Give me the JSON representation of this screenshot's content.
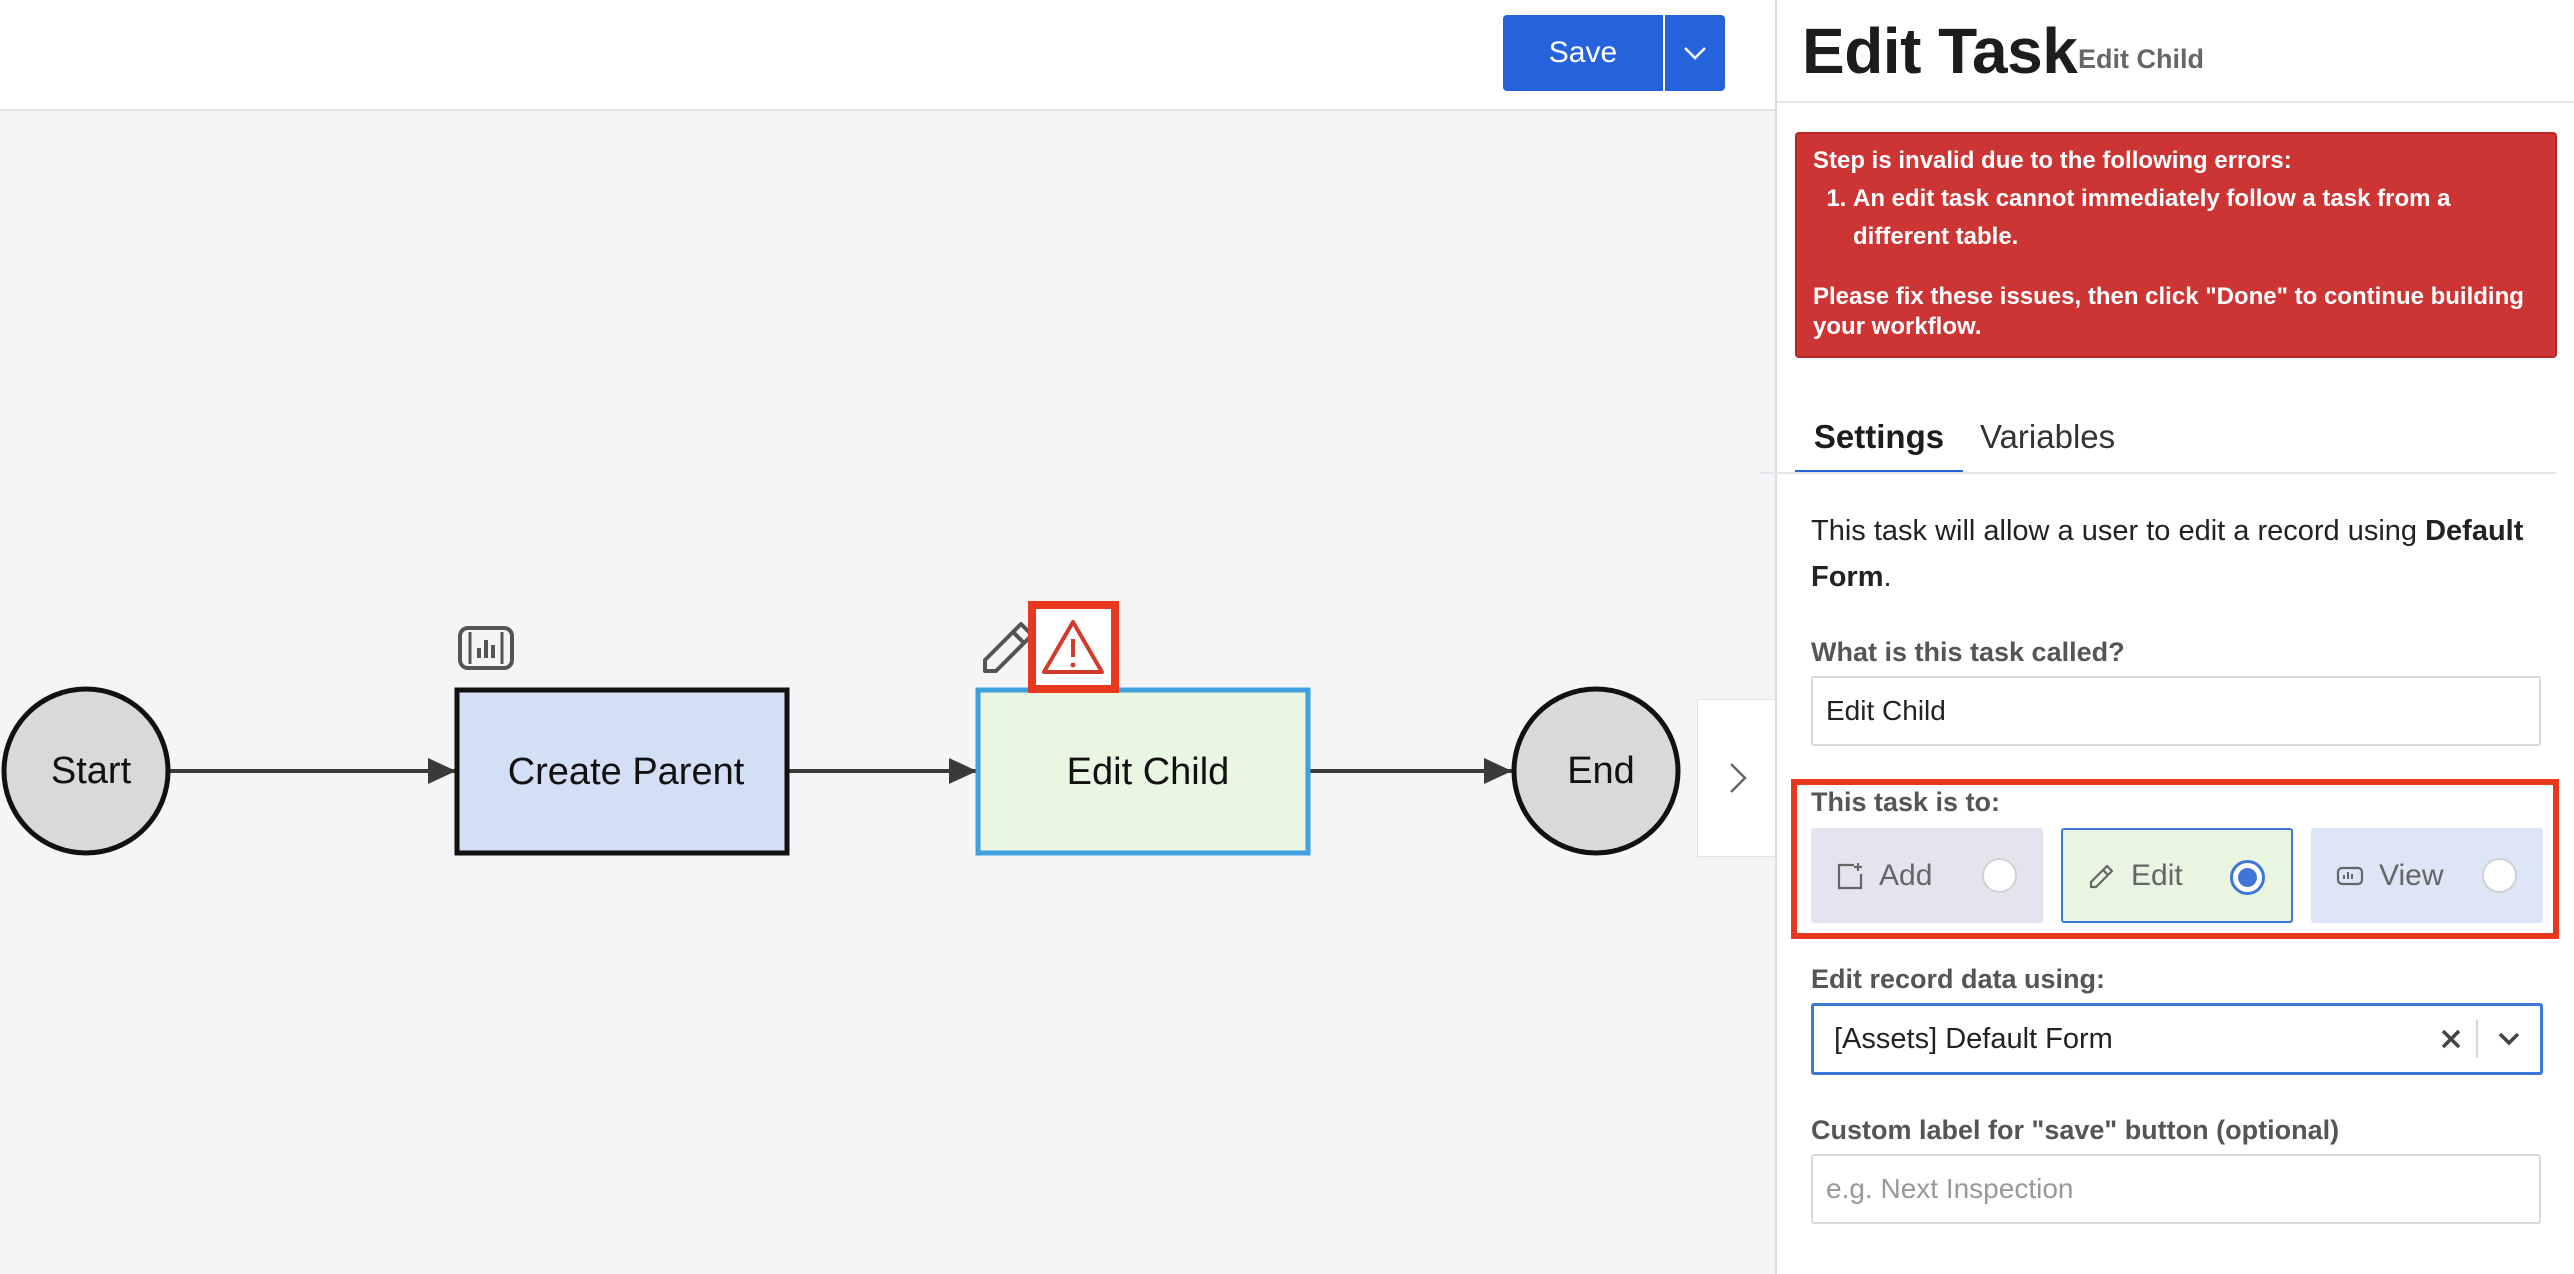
{
  "toolbar": {
    "save_label": "Save"
  },
  "workflow": {
    "start_label": "Start",
    "create_parent_label": "Create Parent",
    "edit_child_label": "Edit Child",
    "end_label": "End"
  },
  "panel": {
    "title": "Edit Task",
    "subtitle": "Edit Child",
    "error": {
      "heading": "Step is invalid due to the following errors:",
      "items": [
        "An edit task cannot immediately follow a task from a different table."
      ],
      "footer": "Please fix these issues, then click \"Done\" to continue building your workflow."
    },
    "tabs": {
      "settings": "Settings",
      "variables": "Variables"
    },
    "description": {
      "prefix": "This task will allow a user to edit a record using ",
      "form_name": "Default Form",
      "suffix": "."
    },
    "task_name": {
      "label": "What is this task called?",
      "value": "Edit Child"
    },
    "task_type": {
      "label": "This task is to:",
      "options": [
        {
          "label": "Add",
          "selected": false
        },
        {
          "label": "Edit",
          "selected": true
        },
        {
          "label": "View",
          "selected": false
        }
      ]
    },
    "record_data": {
      "label": "Edit record data using:",
      "value": "[Assets] Default Form"
    },
    "save_button_label": {
      "label": "Custom label for \"save\" button (optional)",
      "placeholder": "e.g. Next Inspection"
    }
  },
  "colors": {
    "accent": "#2563dc",
    "error": "#cd3434",
    "highlight": "#e8381f",
    "create_node_fill": "#d2dff5",
    "edit_node_fill": "#e9f6e1",
    "edit_node_border": "#3fa0e0",
    "terminal_node_fill": "#d9d9d9"
  }
}
